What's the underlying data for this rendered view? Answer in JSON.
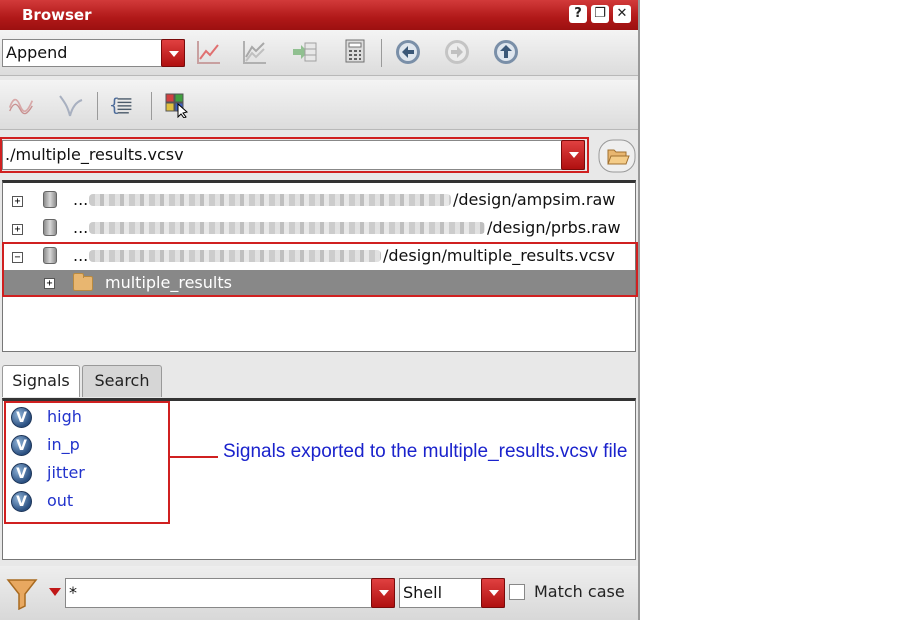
{
  "window": {
    "title": "Browser",
    "buttons": [
      "?",
      "❐",
      "✕"
    ]
  },
  "toolbar1": {
    "mode_combo": "Append",
    "icons": [
      "plot-icon",
      "plot-family-icon",
      "table-export-icon",
      "calculator-icon",
      "back-icon",
      "forward-icon",
      "up-icon"
    ]
  },
  "toolbar2": {
    "icons": [
      "waveform-icon",
      "waveform-sweep-icon",
      "script-icon",
      "select-colors-icon"
    ]
  },
  "path_combo": {
    "value": "./multiple_results.vcsv"
  },
  "tree": {
    "items": [
      {
        "prefix": "...",
        "suffix": "/design/ampsim.raw",
        "expander": "+"
      },
      {
        "prefix": "...",
        "suffix": "/design/prbs.raw",
        "expander": "+"
      },
      {
        "prefix": "...",
        "suffix": "/design/multiple_results.vcsv",
        "expander": "−"
      }
    ],
    "child": {
      "label": "multiple_results",
      "expander": "+"
    }
  },
  "tabs": [
    {
      "label": "Signals",
      "active": true
    },
    {
      "label": "Search",
      "active": false
    }
  ],
  "signals": [
    {
      "icon": "V",
      "name": "high"
    },
    {
      "icon": "V",
      "name": "in_p"
    },
    {
      "icon": "V",
      "name": "jitter"
    },
    {
      "icon": "V",
      "name": "out"
    }
  ],
  "filter": {
    "input_value": "*",
    "mode_combo": "Shell",
    "match_case_label": "Match case",
    "match_case_checked": false
  },
  "annotation": {
    "text": "Signals exported to the multiple_results.vcsv file"
  },
  "colors": {
    "accent_red": "#d02020",
    "signal_text": "#2233cc",
    "annotation_text": "#1a22cc"
  }
}
